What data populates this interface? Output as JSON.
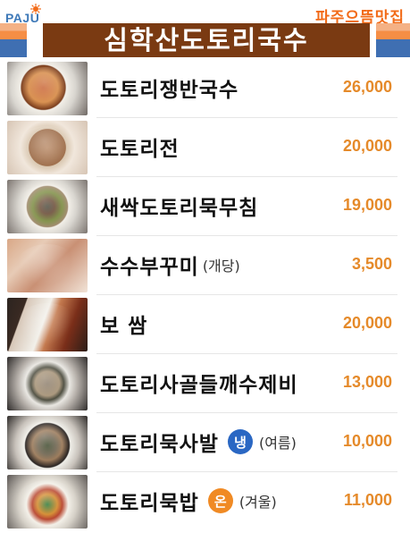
{
  "header": {
    "logo_text": "PAJU",
    "top_right": "파주으뜸맛집",
    "title": "심학산도토리국수",
    "colors": {
      "title_bar": "#7a3a12",
      "accent_orange": "#f26b18",
      "accent_blue": "#3f6fb2"
    }
  },
  "menu": [
    {
      "name": "도토리쟁반국수",
      "price": "26,000"
    },
    {
      "name": "도토리전",
      "price": "20,000"
    },
    {
      "name": "새싹도토리묵무침",
      "price": "19,000"
    },
    {
      "name": "수수부꾸미",
      "extra": "(개당)",
      "price": "3,500"
    },
    {
      "name": "보 쌈",
      "price": "20,000"
    },
    {
      "name": "도토리사골들깨수제비",
      "price": "13,000"
    },
    {
      "name": "도토리묵사발",
      "badge": "냉",
      "badge_color": "#2a67c3",
      "extra": "(여름)",
      "price": "10,000"
    },
    {
      "name": "도토리묵밥",
      "badge": "온",
      "badge_color": "#f08a24",
      "extra": "(겨울)",
      "price": "11,000"
    }
  ],
  "icons": {
    "logo_sun": "sun-icon"
  }
}
